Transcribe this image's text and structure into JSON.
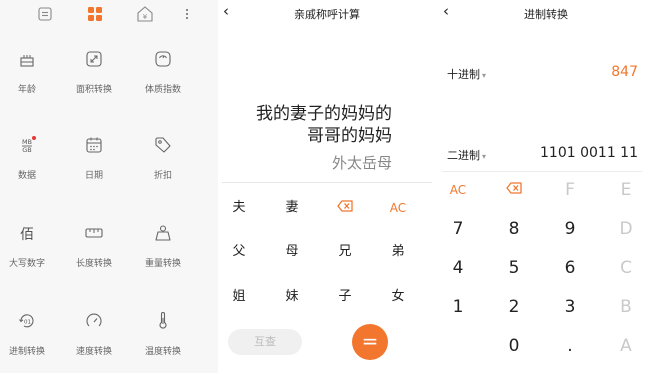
{
  "panel_calc_menu": {
    "tools": [
      {
        "label": "年龄",
        "icon": "cake-icon"
      },
      {
        "label": "面积转换",
        "icon": "area-icon"
      },
      {
        "label": "体质指数",
        "icon": "scale-icon"
      },
      {
        "label": "数据",
        "icon": "data-mb-gb-icon"
      },
      {
        "label": "日期",
        "icon": "calendar-icon"
      },
      {
        "label": "折扣",
        "icon": "tag-icon"
      },
      {
        "label": "大写数字",
        "icon": "chinese-hundred-icon"
      },
      {
        "label": "长度转换",
        "icon": "ruler-icon"
      },
      {
        "label": "重量转换",
        "icon": "weight-icon"
      },
      {
        "label": "进制转换",
        "icon": "base-conversion-icon"
      },
      {
        "label": "速度转换",
        "icon": "speedometer-icon"
      },
      {
        "label": "温度转换",
        "icon": "thermometer-icon"
      }
    ],
    "data_icon_text_top": "MB",
    "data_icon_text_bottom": "GB",
    "chinese_hundred_glyph": "佰",
    "accent": "#f2762e",
    "badge_color": "#e53935"
  },
  "panel_kinship": {
    "title": "亲戚称呼计算",
    "expression_line1": "我的妻子的妈妈的",
    "expression_line2": "哥哥的妈妈",
    "result": "外太岳母",
    "keys_row1": [
      "夫",
      "妻",
      "⌫",
      "AC"
    ],
    "keys_row2": [
      "父",
      "母",
      "兄",
      "弟"
    ],
    "keys_row3": [
      "姐",
      "妹",
      "子",
      "女"
    ],
    "mutual_label": "互查",
    "equals_label": "="
  },
  "panel_base": {
    "title": "进制转换",
    "decimal_label": "十进制",
    "decimal_value": "847",
    "binary_label": "二进制",
    "binary_value": "1101 0011 11",
    "caret": "▾",
    "keypad": [
      [
        "AC",
        "⌫",
        "F",
        "E"
      ],
      [
        "7",
        "8",
        "9",
        "D"
      ],
      [
        "4",
        "5",
        "6",
        "C"
      ],
      [
        "1",
        "2",
        "3",
        "B"
      ],
      [
        "",
        "0",
        ".",
        "A"
      ]
    ]
  }
}
